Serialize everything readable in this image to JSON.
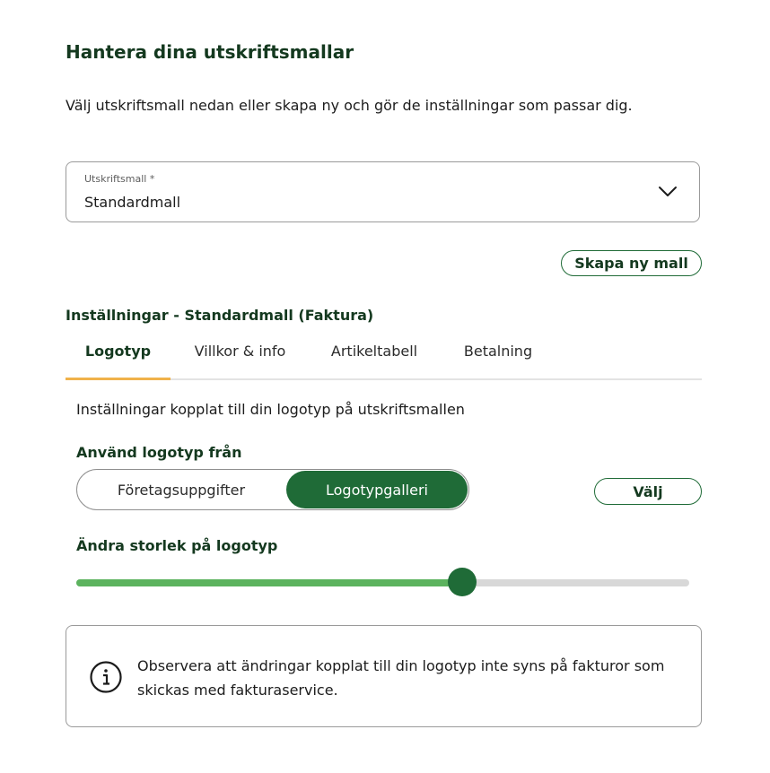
{
  "page": {
    "title": "Hantera dina utskriftsmallar",
    "intro": "Välj utskriftsmall nedan eller skapa ny och gör de inställningar som passar dig."
  },
  "template_select": {
    "label": "Utskriftsmall *",
    "value": "Standardmall",
    "icon": "chevron-down-icon"
  },
  "create_button": {
    "label": "Skapa ny mall"
  },
  "settings": {
    "title": "Inställningar - Standardmall (Faktura)",
    "tabs": [
      {
        "label": "Logotyp",
        "active": true
      },
      {
        "label": "Villkor & info",
        "active": false
      },
      {
        "label": "Artikeltabell",
        "active": false
      },
      {
        "label": "Betalning",
        "active": false
      }
    ],
    "description": "Inställningar kopplat till din logotyp på utskriftsmallen",
    "use_logo_from": {
      "label": "Använd logotyp från",
      "options": [
        "Företagsuppgifter",
        "Logotypgalleri"
      ],
      "selected": "Logotypgalleri"
    },
    "choose_button": {
      "label": "Välj"
    },
    "size": {
      "label": "Ändra storlek på logotyp",
      "value_percent": 63
    },
    "notice": {
      "icon": "info-icon",
      "text": "Observera att ändringar kopplat till din logotyp inte syns på fakturor som skickas med fakturaservice."
    }
  },
  "colors": {
    "brand_dark": "#14391f",
    "brand_green": "#1f6b37",
    "slider_fill": "#5cb35e",
    "tab_accent": "#f0b24a"
  }
}
